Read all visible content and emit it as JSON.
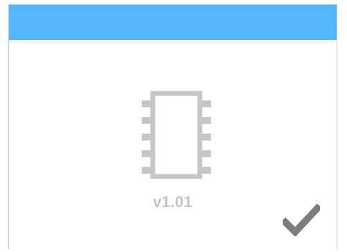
{
  "header": {
    "color": "#55b6fb"
  },
  "device": {
    "icon": "chip-icon",
    "version": "v1.01"
  },
  "actions": {
    "confirm_icon": "checkmark-icon"
  },
  "colors": {
    "icon_gray": "#c6c6c6",
    "text_gray": "#c3c3c3",
    "check_gray": "#7d7d7d"
  }
}
